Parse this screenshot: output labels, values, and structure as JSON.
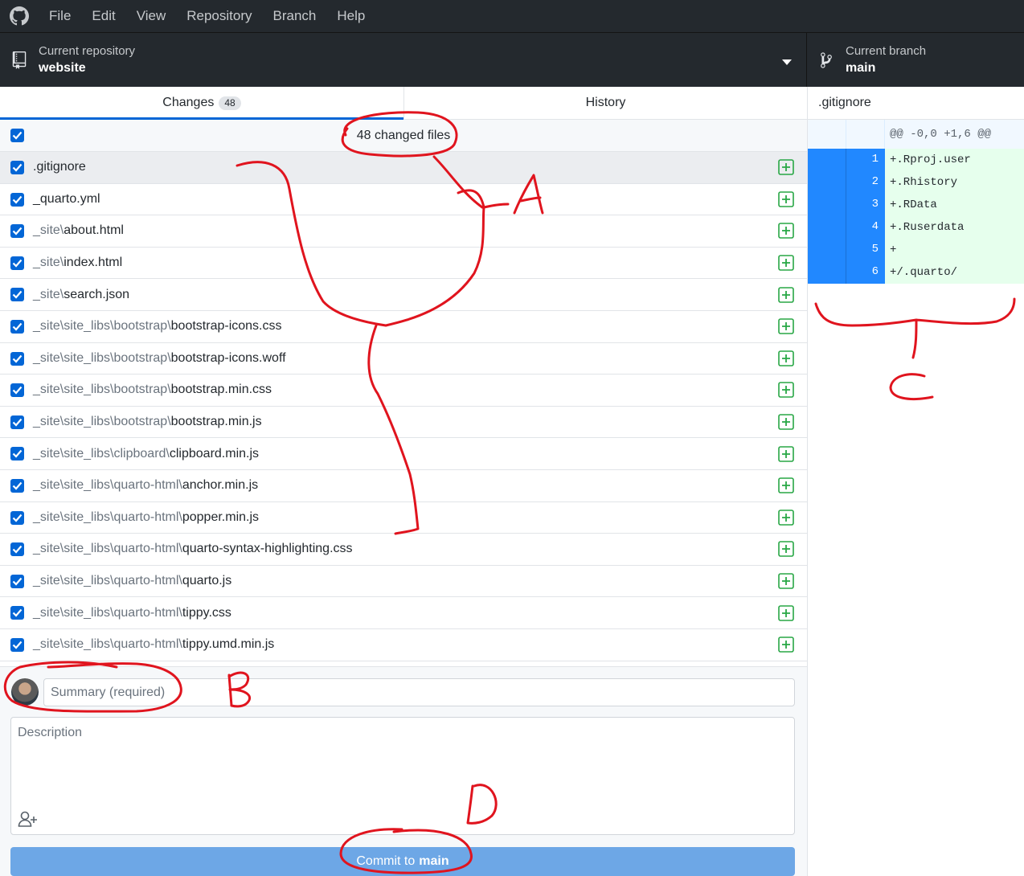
{
  "menubar": {
    "items": [
      "File",
      "Edit",
      "View",
      "Repository",
      "Branch",
      "Help"
    ]
  },
  "toolbar": {
    "repo_caption": "Current repository",
    "repo_name": "website",
    "branch_caption": "Current branch",
    "branch_name": "main"
  },
  "tabs": {
    "changes_label": "Changes",
    "changes_count": "48",
    "history_label": "History"
  },
  "changes": {
    "header": "48 changed files",
    "files": [
      {
        "dir": "",
        "name": ".gitignore"
      },
      {
        "dir": "",
        "name": "_quarto.yml"
      },
      {
        "dir": "_site\\",
        "name": "about.html"
      },
      {
        "dir": "_site\\",
        "name": "index.html"
      },
      {
        "dir": "_site\\",
        "name": "search.json"
      },
      {
        "dir": "_site\\site_libs\\bootstrap\\",
        "name": "bootstrap-icons.css"
      },
      {
        "dir": "_site\\site_libs\\bootstrap\\",
        "name": "bootstrap-icons.woff"
      },
      {
        "dir": "_site\\site_libs\\bootstrap\\",
        "name": "bootstrap.min.css"
      },
      {
        "dir": "_site\\site_libs\\bootstrap\\",
        "name": "bootstrap.min.js"
      },
      {
        "dir": "_site\\site_libs\\clipboard\\",
        "name": "clipboard.min.js"
      },
      {
        "dir": "_site\\site_libs\\quarto-html\\",
        "name": "anchor.min.js"
      },
      {
        "dir": "_site\\site_libs\\quarto-html\\",
        "name": "popper.min.js"
      },
      {
        "dir": "_site\\site_libs\\quarto-html\\",
        "name": "quarto-syntax-highlighting.css"
      },
      {
        "dir": "_site\\site_libs\\quarto-html\\",
        "name": "quarto.js"
      },
      {
        "dir": "_site\\site_libs\\quarto-html\\",
        "name": "tippy.css"
      },
      {
        "dir": "_site\\site_libs\\quarto-html\\",
        "name": "tippy.umd.min.js"
      }
    ]
  },
  "commit": {
    "summary_placeholder": "Summary (required)",
    "description_placeholder": "Description",
    "button_prefix": "Commit to",
    "button_branch": "main"
  },
  "diff": {
    "filename": ".gitignore",
    "hunk_header": "@@ -0,0 +1,6 @@",
    "lines": [
      {
        "num": "1",
        "text": "+.Rproj.user"
      },
      {
        "num": "2",
        "text": "+.Rhistory"
      },
      {
        "num": "3",
        "text": "+.RData"
      },
      {
        "num": "4",
        "text": "+.Ruserdata"
      },
      {
        "num": "5",
        "text": "+"
      },
      {
        "num": "6",
        "text": "+/.quarto/"
      }
    ]
  },
  "annotations": {
    "labels": [
      "A",
      "B",
      "C",
      "D"
    ],
    "color": "#e0141e"
  },
  "colors": {
    "accent": "#0366d6",
    "added": "#28a745",
    "chrome": "#24292e"
  }
}
